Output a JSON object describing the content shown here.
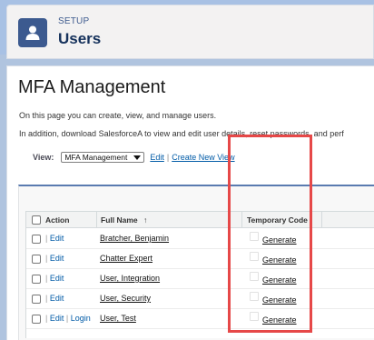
{
  "header": {
    "section": "SETUP",
    "title": "Users"
  },
  "page": {
    "heading": "MFA Management",
    "desc1": "On this page you can create, view, and manage users.",
    "desc2": "In addition, download SalesforceA to view and edit user details, reset passwords, and perf"
  },
  "view": {
    "label": "View:",
    "selected": "MFA Management",
    "edit": "Edit",
    "separator": "|",
    "create": "Create New View"
  },
  "table": {
    "headers": {
      "action": "Action",
      "full_name": "Full Name",
      "sort_arrow": "↑",
      "temp_code": "Temporary Code"
    },
    "rows": [
      {
        "actions": [
          "Edit"
        ],
        "name": "Bratcher, Benjamin",
        "code": "Generate"
      },
      {
        "actions": [
          "Edit"
        ],
        "name": "Chatter Expert",
        "code": "Generate"
      },
      {
        "actions": [
          "Edit"
        ],
        "name": "User, Integration",
        "code": "Generate"
      },
      {
        "actions": [
          "Edit"
        ],
        "name": "User, Security",
        "code": "Generate"
      },
      {
        "actions": [
          "Edit",
          "Login"
        ],
        "name": "User, Test",
        "code": "Generate"
      }
    ]
  },
  "colors": {
    "header_icon": "#3c5a8f",
    "link": "#015ba7",
    "highlight": "#e64848",
    "panel_top_border": "#5a7bb0"
  },
  "icons": {
    "header": "user-icon",
    "dropdown": "chevron-down-icon"
  }
}
